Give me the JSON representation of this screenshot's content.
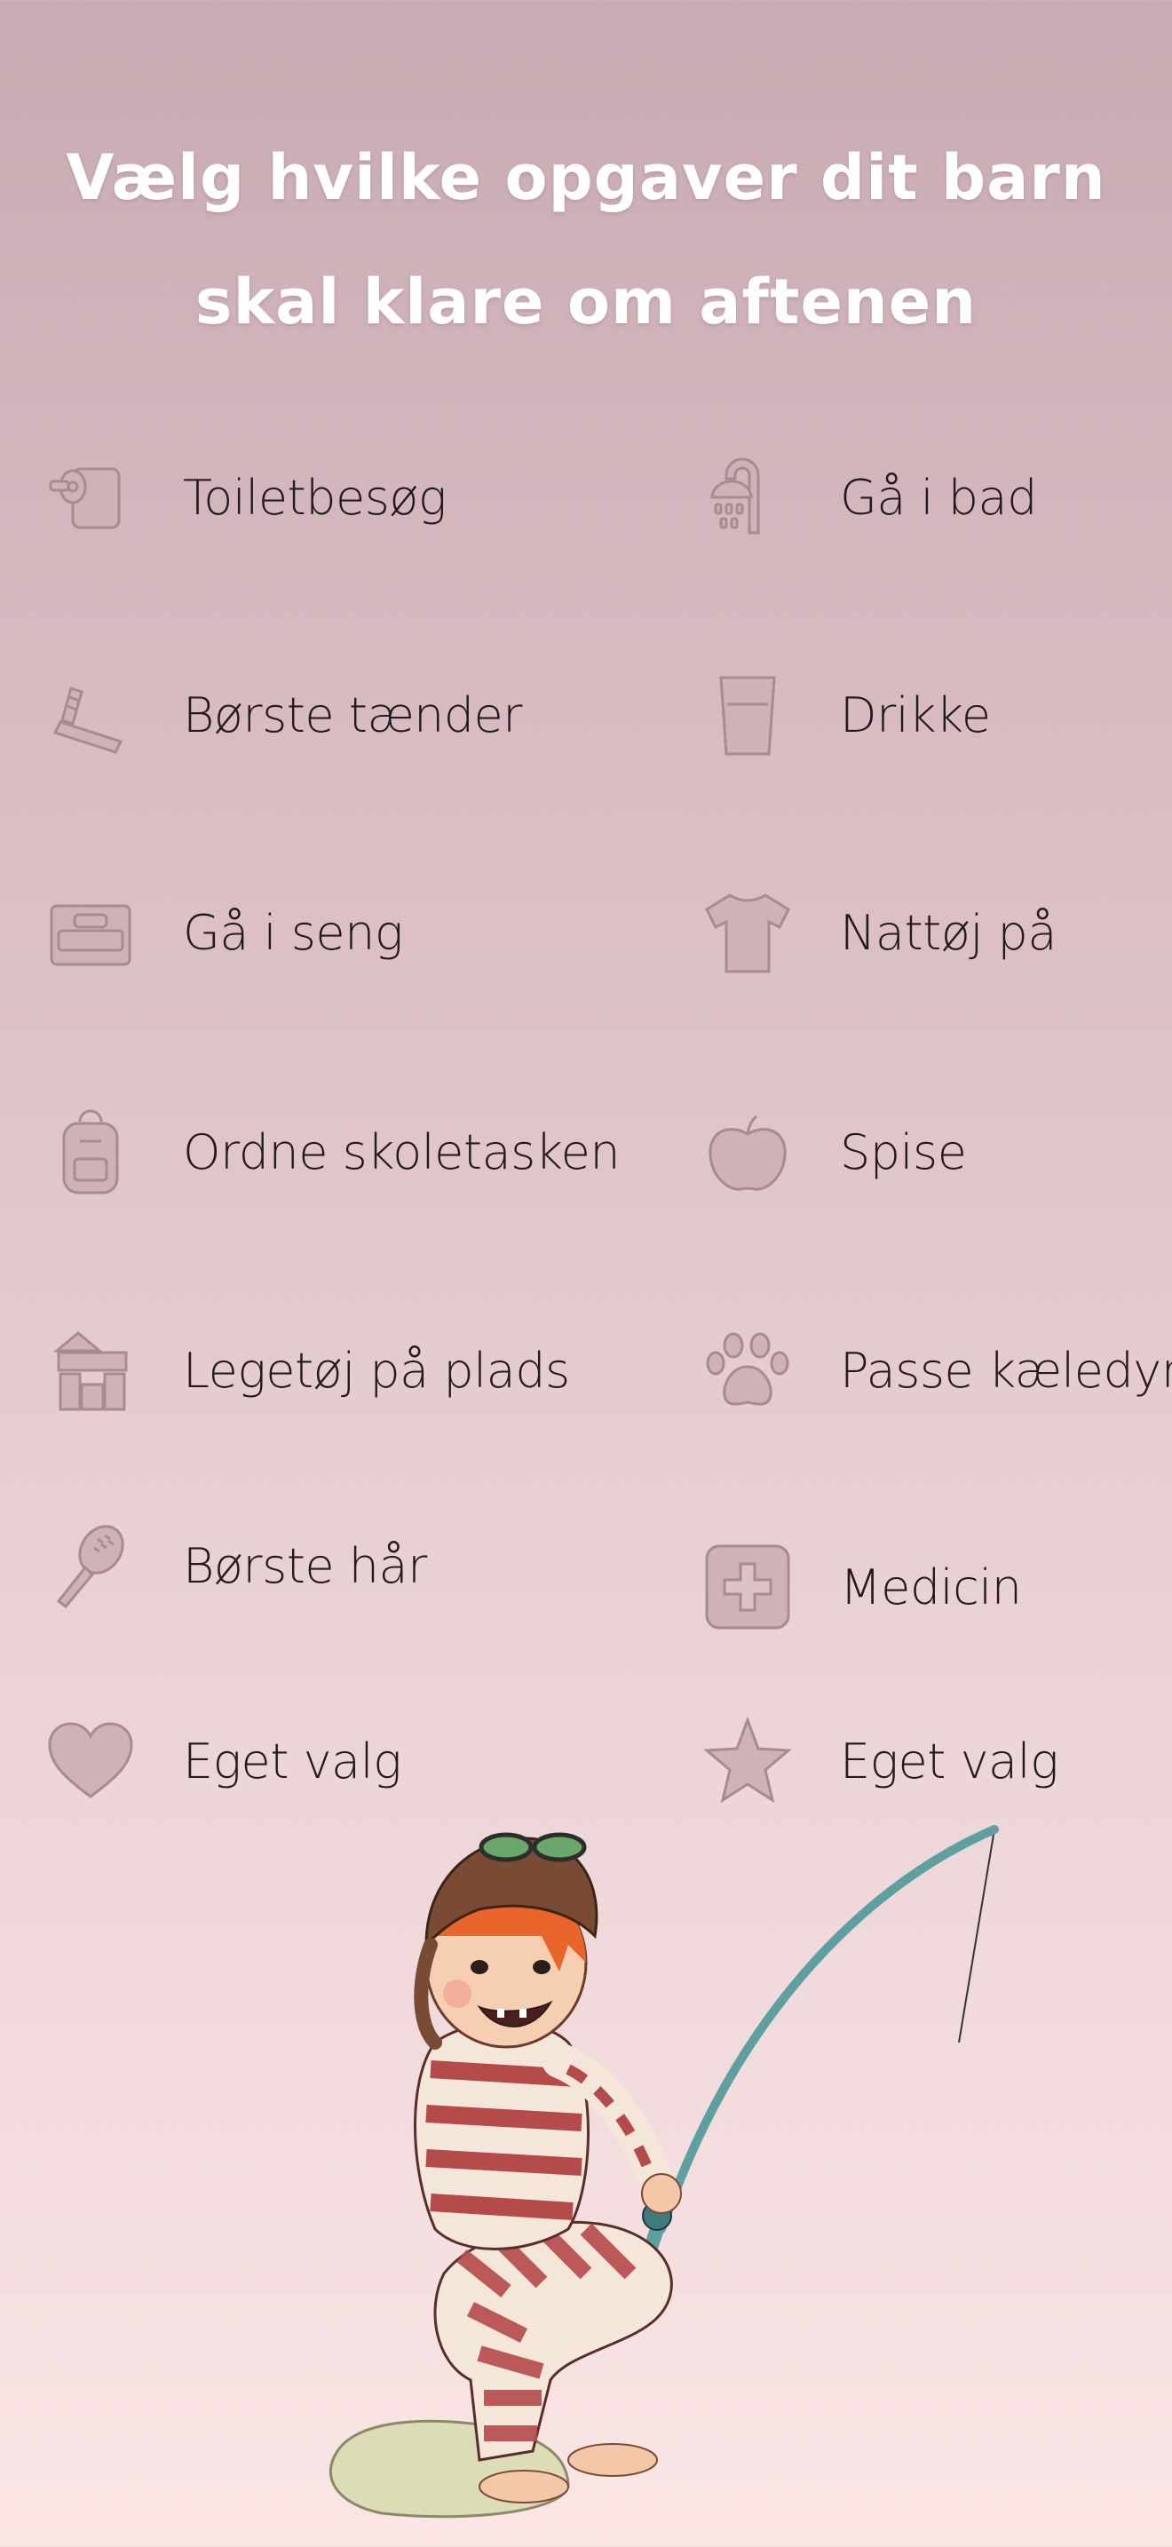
{
  "title": {
    "line1": "Vælg hvilke opgaver dit barn",
    "line2": "skal klare om aftenen"
  },
  "tasks": [
    {
      "label": "Toiletbesøg",
      "icon": "toilet-paper-icon"
    },
    {
      "label": "Gå i bad",
      "icon": "shower-icon"
    },
    {
      "label": "Børste tænder",
      "icon": "toothbrush-icon"
    },
    {
      "label": "Drikke",
      "icon": "glass-icon"
    },
    {
      "label": "Gå i seng",
      "icon": "bed-icon"
    },
    {
      "label": "Nattøj på",
      "icon": "tshirt-icon"
    },
    {
      "label": "Ordne skoletasken",
      "icon": "backpack-icon"
    },
    {
      "label": "Spise",
      "icon": "apple-icon"
    },
    {
      "label": "Legetøj på plads",
      "icon": "toy-blocks-icon"
    },
    {
      "label": "Passe kæledyr",
      "icon": "paw-icon"
    },
    {
      "label": "Børste hår",
      "icon": "hairbrush-icon"
    },
    {
      "label": "Medicin",
      "icon": "medicine-icon"
    },
    {
      "label": "Eget valg",
      "icon": "heart-icon"
    },
    {
      "label": "Eget valg",
      "icon": "star-icon"
    }
  ],
  "colors": {
    "background_top": "#c9acb3",
    "background_bottom": "#fae6e5",
    "icon_fill": "#cfb2b8",
    "title_text": "#ffffff"
  }
}
